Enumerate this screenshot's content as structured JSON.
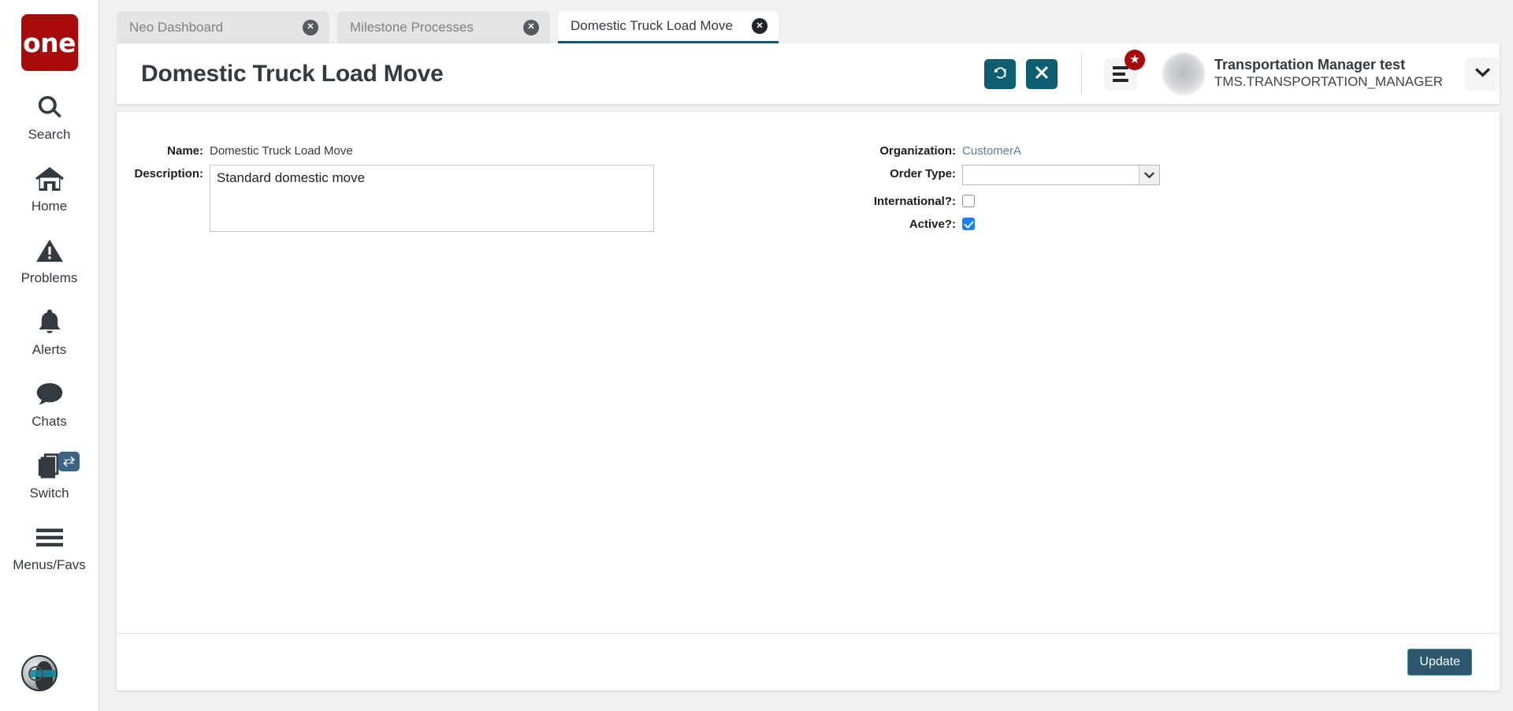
{
  "sidebar": {
    "logo_text": "one",
    "items": [
      {
        "label": "Search",
        "icon": "search-icon"
      },
      {
        "label": "Home",
        "icon": "home-icon"
      },
      {
        "label": "Problems",
        "icon": "warning-triangle-icon"
      },
      {
        "label": "Alerts",
        "icon": "bell-icon"
      },
      {
        "label": "Chats",
        "icon": "chat-bubble-icon"
      },
      {
        "label": "Switch",
        "icon": "windows-switch-icon"
      },
      {
        "label": "Menus/Favs",
        "icon": "hamburger-icon"
      }
    ],
    "assistant_icon": "ai-assistant-avatar-icon"
  },
  "tabs": [
    {
      "label": "Neo Dashboard",
      "active": false
    },
    {
      "label": "Milestone Processes",
      "active": false
    },
    {
      "label": "Domestic Truck Load Move",
      "active": true
    }
  ],
  "header": {
    "title": "Domestic Truck Load Move",
    "refresh_icon": "refresh-icon",
    "close_icon": "close-x-icon",
    "menu_icon": "hamburger-menu-icon",
    "menu_badge_icon": "star-badge-icon",
    "caret_icon": "chevron-down-icon",
    "user": {
      "name": "Transportation Manager test",
      "role": "TMS.TRANSPORTATION_MANAGER"
    }
  },
  "form": {
    "left": {
      "name_label": "Name:",
      "name_value": "Domestic Truck Load Move",
      "description_label": "Description:",
      "description_value": "Standard domestic move",
      "description_placeholder": ""
    },
    "right": {
      "organization_label": "Organization:",
      "organization_value": "CustomerA",
      "order_type_label": "Order Type:",
      "order_type_value": "",
      "international_label": "International?:",
      "international_checked": false,
      "active_label": "Active?:",
      "active_checked": true
    }
  },
  "footer": {
    "update_label": "Update"
  },
  "colors": {
    "brand_red": "#a80b0b",
    "teal_button": "#0e5e72",
    "active_tab_underline": "#11596b",
    "update_button": "#2b566e",
    "checkbox_checked": "#1a81f0",
    "link_blue": "#5a7f95"
  }
}
